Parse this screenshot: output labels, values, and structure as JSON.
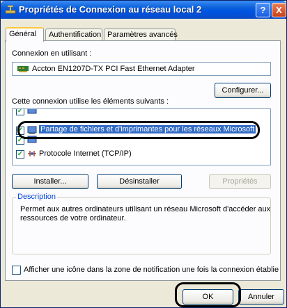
{
  "window": {
    "title": "Propriétés de Connexion au réseau local 2",
    "help_label": "?",
    "close_label": "X"
  },
  "tabs": [
    {
      "label": "Général",
      "active": true
    },
    {
      "label": "Authentification",
      "active": false
    },
    {
      "label": "Paramètres avancés",
      "active": false
    }
  ],
  "connection": {
    "label": "Connexion en utilisant :",
    "adapter": "Accton EN1207D-TX PCI Fast Ethernet Adapter",
    "configure_label": "Configurer..."
  },
  "components": {
    "label": "Cette connexion utilise les éléments suivants :",
    "items": [
      {
        "label": "",
        "checked": true
      },
      {
        "label": "Partage de fichiers et d'imprimantes pour les réseaux Microsoft",
        "checked": true,
        "selected": true
      },
      {
        "label": "",
        "checked": true
      },
      {
        "label": "Protocole Internet (TCP/IP)",
        "checked": true
      }
    ]
  },
  "buttons": {
    "install": "Installer...",
    "uninstall": "Désinstaller",
    "properties": "Propriétés"
  },
  "description": {
    "legend": "Description",
    "text_line1": "Permet aux autres ordinateurs utilisant un réseau Microsoft d'accéder aux",
    "text_line2": "ressources de votre ordinateur."
  },
  "notify": {
    "label": "Afficher une icône dans la zone de notification une fois la connexion établie",
    "checked": false
  },
  "footer": {
    "ok": "OK",
    "cancel": "Annuler"
  }
}
